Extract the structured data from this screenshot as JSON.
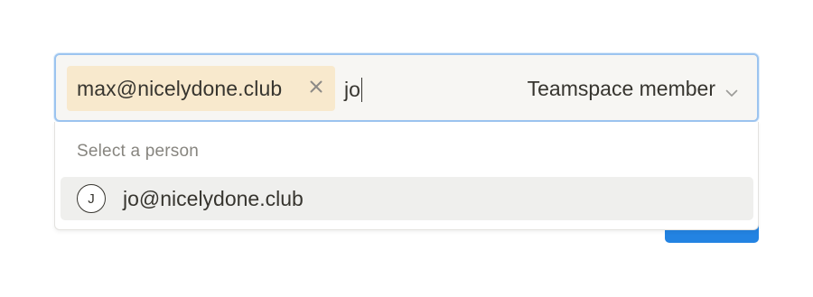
{
  "invite": {
    "selected_chip": {
      "label": "max@nicelydone.club",
      "remove_icon": "close-icon"
    },
    "query_value": "jo",
    "role": {
      "selected": "Teamspace member",
      "icon": "chevron-down-icon"
    }
  },
  "suggestions": {
    "header": "Select a person",
    "items": [
      {
        "avatar_initial": "J",
        "label": "jo@nicelydone.club"
      }
    ]
  },
  "colors": {
    "chip_background": "#f8e9cd",
    "input_background": "#f7f6f3",
    "focus_border": "#9cc4ef",
    "highlight_row": "#efefed",
    "primary_button": "#2383e2"
  }
}
